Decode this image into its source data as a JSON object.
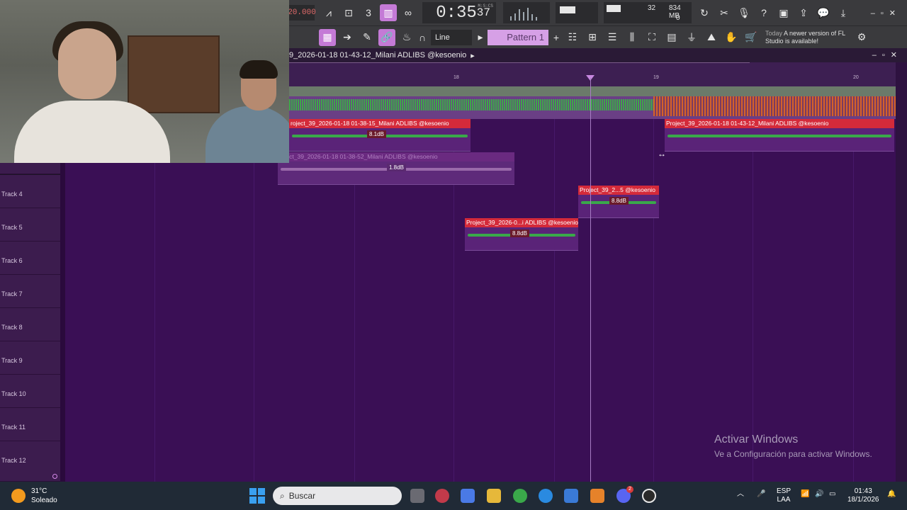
{
  "toolbar": {
    "tempo": "20.000",
    "time_main": "0:35",
    "time_small": "37",
    "time_unit": "M:S:CS",
    "cpu_value": "32",
    "memory": "834 MB",
    "poly": "0",
    "snap": "Line",
    "pattern": "Pattern 1",
    "news_today": "Today",
    "news_text": "A newer version of FL Studio is available!"
  },
  "playlist": {
    "title": "9_2026-01-18 01-43-12_Milani ADLIBS @kesoenio",
    "ruler_bars": [
      "18",
      "19",
      "20"
    ],
    "tracks": [
      "Track 4",
      "Track 5",
      "Track 6",
      "Track 7",
      "Track 8",
      "Track 9",
      "Track 10",
      "Track 11",
      "Track 12"
    ],
    "clips": [
      {
        "name": "roject_39_2026-01-18 01-38-15_Milani ADLIBS @kesoenio",
        "db": "8.1dB"
      },
      {
        "name": "roject_39_2026-01-18 01-38-52_Milani ADLIBS @kesoenio",
        "db": "1.8dB"
      },
      {
        "name": "Project_39_2026-01-18 01-43-12_Milani ADLIBS @kesoenio",
        "db": ""
      },
      {
        "name": "Project_39_2...5 @kesoenio",
        "db": "8.8dB"
      },
      {
        "name": "Project_39_2026-0...i ADLIBS @kesoenio",
        "db": "8.8dB"
      }
    ]
  },
  "watermark": {
    "title": "Activar Windows",
    "subtitle": "Ve a Configuración para activar Windows."
  },
  "taskbar": {
    "temperature": "31°C",
    "weather": "Soleado",
    "search_placeholder": "Buscar",
    "lang_top": "ESP",
    "lang_bottom": "LAA",
    "time": "01:43",
    "date": "18/1/2026",
    "discord_badge": "2"
  }
}
